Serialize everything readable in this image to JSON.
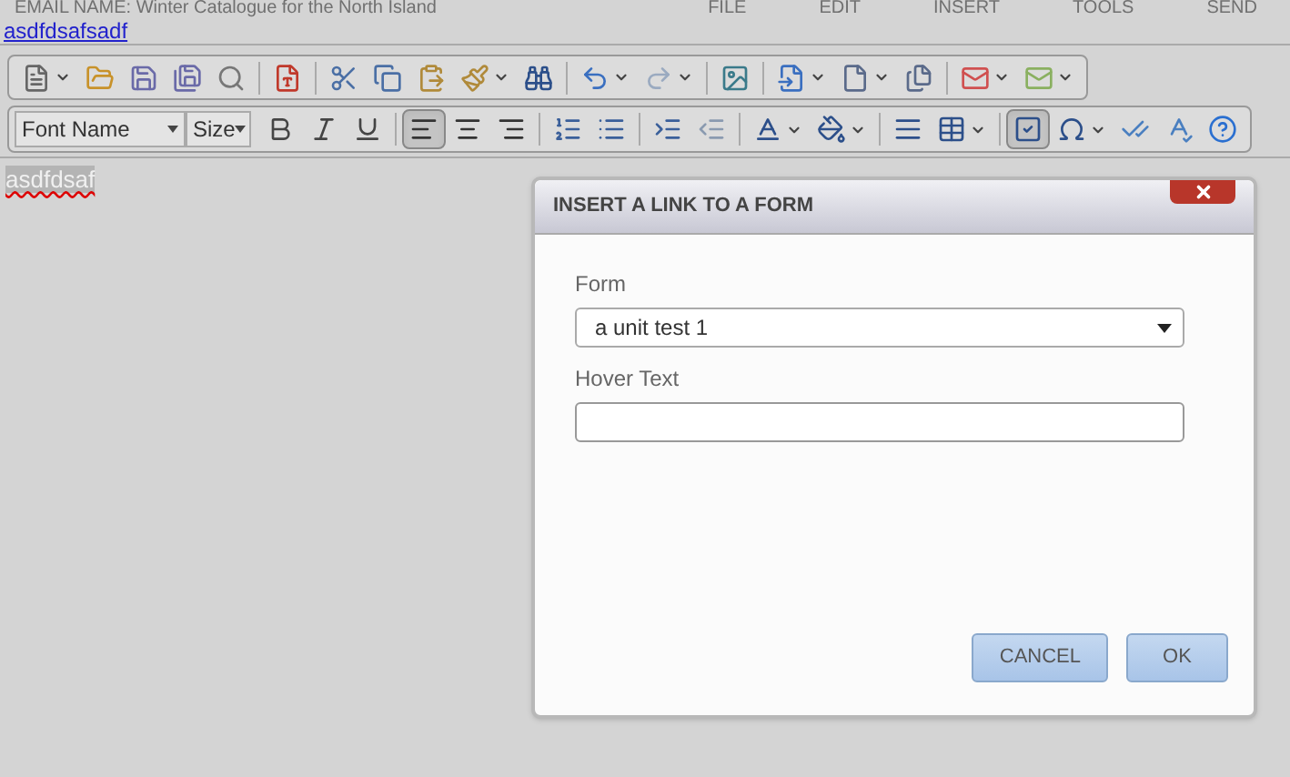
{
  "header": {
    "email_name": "EMAIL NAME: Winter Catalogue for the North Island",
    "menu": [
      {
        "label": "FILE"
      },
      {
        "label": "EDIT"
      },
      {
        "label": "INSERT"
      },
      {
        "label": "TOOLS"
      },
      {
        "label": "SEND"
      }
    ]
  },
  "link": "asdfdsafsadf",
  "toolbar1": [
    {
      "kind": "new",
      "pressed": false,
      "dropdown": true
    },
    {
      "kind": "open",
      "pressed": false,
      "dropdown": false
    },
    {
      "kind": "save",
      "pressed": false,
      "dropdown": false
    },
    {
      "kind": "save-as",
      "pressed": false,
      "dropdown": false
    },
    {
      "kind": "preview",
      "pressed": false,
      "dropdown": false
    },
    {
      "kind": "pdf",
      "pressed": false,
      "dropdown": false
    },
    {
      "kind": "cut",
      "pressed": false,
      "dropdown": false
    },
    {
      "kind": "copy",
      "pressed": false,
      "dropdown": false
    },
    {
      "kind": "paste",
      "pressed": false,
      "dropdown": false
    },
    {
      "kind": "format-brush",
      "pressed": false,
      "dropdown": true
    },
    {
      "kind": "find",
      "pressed": false,
      "dropdown": false
    },
    {
      "kind": "undo",
      "pressed": false,
      "dropdown": true
    },
    {
      "kind": "redo",
      "pressed": false,
      "dropdown": true
    },
    {
      "kind": "image",
      "pressed": false,
      "dropdown": false
    },
    {
      "kind": "insert-file",
      "pressed": false,
      "dropdown": true
    },
    {
      "kind": "page",
      "pressed": false,
      "dropdown": true
    },
    {
      "kind": "pages",
      "pressed": false,
      "dropdown": false
    },
    {
      "kind": "mail",
      "pressed": false,
      "dropdown": true
    },
    {
      "kind": "mail-alt",
      "pressed": false,
      "dropdown": true
    }
  ],
  "font_name": "Font Name",
  "font_size": "Size",
  "toolbar2": [
    {
      "kind": "bold",
      "pressed": false,
      "dropdown": false
    },
    {
      "kind": "italic",
      "pressed": false,
      "dropdown": false
    },
    {
      "kind": "underline",
      "pressed": false,
      "dropdown": false
    },
    {
      "kind": "align-left",
      "pressed": true,
      "dropdown": false
    },
    {
      "kind": "align-center",
      "pressed": false,
      "dropdown": false
    },
    {
      "kind": "align-right",
      "pressed": false,
      "dropdown": false
    },
    {
      "kind": "ordered-list",
      "pressed": false,
      "dropdown": false
    },
    {
      "kind": "bullet-list",
      "pressed": false,
      "dropdown": false
    },
    {
      "kind": "indent",
      "pressed": false,
      "dropdown": false
    },
    {
      "kind": "outdent",
      "pressed": false,
      "dropdown": false
    },
    {
      "kind": "font-color",
      "pressed": false,
      "dropdown": true
    },
    {
      "kind": "fill-color",
      "pressed": false,
      "dropdown": true
    },
    {
      "kind": "paragraph",
      "pressed": false,
      "dropdown": false
    },
    {
      "kind": "table",
      "pressed": false,
      "dropdown": true
    },
    {
      "kind": "show-borders",
      "pressed": true,
      "dropdown": false
    },
    {
      "kind": "symbol",
      "pressed": false,
      "dropdown": true
    },
    {
      "kind": "validate",
      "pressed": false,
      "dropdown": false
    },
    {
      "kind": "spellcheck",
      "pressed": false,
      "dropdown": false
    },
    {
      "kind": "help",
      "pressed": false,
      "dropdown": false
    }
  ],
  "editor_text": "asdfdsaf",
  "dialog": {
    "title": "INSERT A LINK TO A FORM",
    "form_label": "Form",
    "form_value": "a unit test 1",
    "hover_label": "Hover Text",
    "buttons": [
      {
        "label": "CANCEL"
      },
      {
        "label": "OK"
      }
    ]
  }
}
